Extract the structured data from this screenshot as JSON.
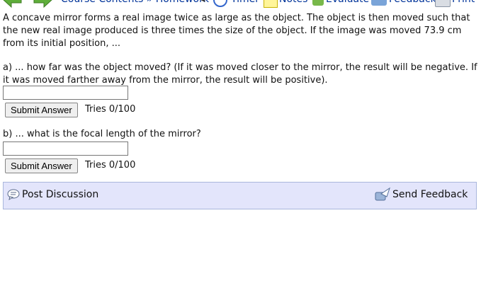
{
  "toolbar": {
    "breadcrumb": "Course Contents » Homework",
    "timer_label": "Timer",
    "notes_label": "Notes",
    "evaluate_label": "Evaluate",
    "feedback_label": "Feedback",
    "print_label": "Print"
  },
  "problem": {
    "text": "A concave mirror forms a real image twice as large as the object. The object is then moved such that the new real image produced is three times the size of the object. If the image was moved 73.9 cm from its initial position, ..."
  },
  "part_a": {
    "question": "a) ... how far was the object moved? (If it was moved closer to the mirror, the result will be negative. If it was moved farther away from the mirror, the result will be positive).",
    "answer_value": "",
    "submit_label": "Submit Answer",
    "tries": "Tries 0/100"
  },
  "part_b": {
    "question": "b) ... what is the focal length of the mirror?",
    "answer_value": "",
    "submit_label": "Submit Answer",
    "tries": "Tries 0/100"
  },
  "discussion": {
    "post_label": "Post Discussion",
    "send_feedback_label": "Send Feedback"
  }
}
